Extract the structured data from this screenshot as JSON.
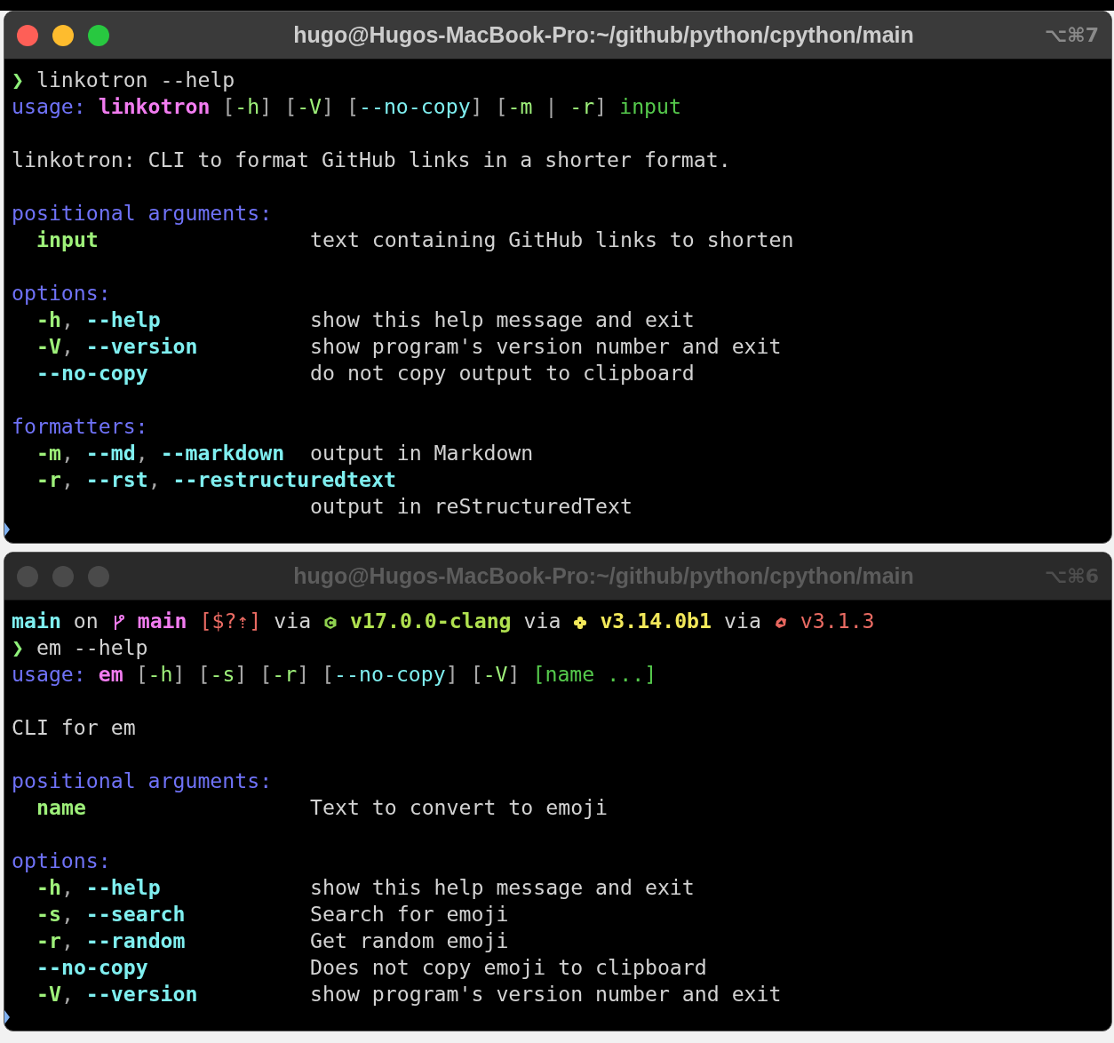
{
  "windows": [
    {
      "title": "hugo@Hugos-MacBook-Pro:~/github/python/cpython/main",
      "shortcut": "⌥⌘7",
      "active": true,
      "lines": [
        {
          "kind": "command",
          "prompt": "❯",
          "text": "linkotron --help"
        },
        {
          "kind": "tokens",
          "groups": [
            [
              {
                "text": "usage:",
                "kind": "label"
              }
            ],
            [
              {
                "text": "linkotron",
                "kind": "prog"
              }
            ],
            [
              {
                "text": "[",
                "kind": "bracket"
              },
              {
                "text": "-h",
                "kind": "short"
              },
              {
                "text": "]",
                "kind": "bracket"
              }
            ],
            [
              {
                "text": "[",
                "kind": "bracket"
              },
              {
                "text": "-V",
                "kind": "short"
              },
              {
                "text": "]",
                "kind": "bracket"
              }
            ],
            [
              {
                "text": "[",
                "kind": "bracket"
              },
              {
                "text": "--no-copy",
                "kind": "long"
              },
              {
                "text": "]",
                "kind": "bracket"
              }
            ],
            [
              {
                "text": "[",
                "kind": "bracket"
              },
              {
                "text": "-m",
                "kind": "short"
              }
            ],
            [
              {
                "text": "|",
                "kind": "bracket"
              }
            ],
            [
              {
                "text": "-r",
                "kind": "short"
              },
              {
                "text": "]",
                "kind": "bracket"
              }
            ],
            [
              {
                "text": "input",
                "kind": "meta"
              }
            ]
          ]
        },
        {
          "kind": "blank"
        },
        {
          "kind": "plain",
          "text": "linkotron: CLI to format GitHub links in a shorter format."
        },
        {
          "kind": "blank"
        },
        {
          "kind": "heading",
          "text": "positional arguments:"
        },
        {
          "kind": "option",
          "flags": [
            [
              {
                "text": "input",
                "kind": "short"
              }
            ]
          ],
          "desc": "text containing GitHub links to shorten"
        },
        {
          "kind": "blank"
        },
        {
          "kind": "heading",
          "text": "options:"
        },
        {
          "kind": "option",
          "flags": [
            [
              {
                "text": "-h",
                "kind": "short"
              },
              {
                "text": ",",
                "kind": "punct"
              }
            ],
            [
              {
                "text": "--help",
                "kind": "long"
              }
            ]
          ],
          "desc": "show this help message and exit"
        },
        {
          "kind": "option",
          "flags": [
            [
              {
                "text": "-V",
                "kind": "short"
              },
              {
                "text": ",",
                "kind": "punct"
              }
            ],
            [
              {
                "text": "--version",
                "kind": "long"
              }
            ]
          ],
          "desc": "show program's version number and exit"
        },
        {
          "kind": "option",
          "flags": [
            [
              {
                "text": "--no-copy",
                "kind": "long"
              }
            ]
          ],
          "desc": "do not copy output to clipboard"
        },
        {
          "kind": "blank"
        },
        {
          "kind": "heading",
          "text": "formatters:"
        },
        {
          "kind": "option",
          "flags": [
            [
              {
                "text": "-m",
                "kind": "short"
              },
              {
                "text": ",",
                "kind": "punct"
              }
            ],
            [
              {
                "text": "--md",
                "kind": "long"
              },
              {
                "text": ",",
                "kind": "punct"
              }
            ],
            [
              {
                "text": "--markdown",
                "kind": "long"
              }
            ]
          ],
          "desc": "output in Markdown"
        },
        {
          "kind": "option",
          "flags": [
            [
              {
                "text": "-r",
                "kind": "short"
              },
              {
                "text": ",",
                "kind": "punct"
              }
            ],
            [
              {
                "text": "--rst",
                "kind": "long"
              },
              {
                "text": ",",
                "kind": "punct"
              }
            ],
            [
              {
                "text": "--restructuredtext",
                "kind": "long"
              }
            ]
          ]
        },
        {
          "kind": "desc",
          "desc": "output in reStructuredText"
        }
      ]
    },
    {
      "title": "hugo@Hugos-MacBook-Pro:~/github/python/cpython/main",
      "shortcut": "⌥⌘6",
      "active": false,
      "lines": [
        {
          "kind": "prompt",
          "dir": "main",
          "on": "on",
          "branch": "main",
          "status": "[$?⇡]",
          "tools": [
            {
              "via": "via",
              "kind": "clang",
              "version": "v17.0.0-clang"
            },
            {
              "via": "via",
              "kind": "python",
              "version": "v3.14.0b1"
            },
            {
              "via": "via",
              "kind": "ruby",
              "version": "v3.1.3"
            }
          ]
        },
        {
          "kind": "command",
          "prompt": "❯",
          "text": "em --help"
        },
        {
          "kind": "tokens",
          "groups": [
            [
              {
                "text": "usage:",
                "kind": "label"
              }
            ],
            [
              {
                "text": "em",
                "kind": "prog"
              }
            ],
            [
              {
                "text": "[",
                "kind": "bracket"
              },
              {
                "text": "-h",
                "kind": "short"
              },
              {
                "text": "]",
                "kind": "bracket"
              }
            ],
            [
              {
                "text": "[",
                "kind": "bracket"
              },
              {
                "text": "-s",
                "kind": "short"
              },
              {
                "text": "]",
                "kind": "bracket"
              }
            ],
            [
              {
                "text": "[",
                "kind": "bracket"
              },
              {
                "text": "-r",
                "kind": "short"
              },
              {
                "text": "]",
                "kind": "bracket"
              }
            ],
            [
              {
                "text": "[",
                "kind": "bracket"
              },
              {
                "text": "--no-copy",
                "kind": "long"
              },
              {
                "text": "]",
                "kind": "bracket"
              }
            ],
            [
              {
                "text": "[",
                "kind": "bracket"
              },
              {
                "text": "-V",
                "kind": "short"
              },
              {
                "text": "]",
                "kind": "bracket"
              }
            ],
            [
              {
                "text": "[name",
                "kind": "meta"
              }
            ],
            [
              {
                "text": "...]",
                "kind": "meta"
              }
            ]
          ]
        },
        {
          "kind": "blank"
        },
        {
          "kind": "plain",
          "text": "CLI for em"
        },
        {
          "kind": "blank"
        },
        {
          "kind": "heading",
          "text": "positional arguments:"
        },
        {
          "kind": "option",
          "flags": [
            [
              {
                "text": "name",
                "kind": "short"
              }
            ]
          ],
          "desc": "Text to convert to emoji"
        },
        {
          "kind": "blank"
        },
        {
          "kind": "heading",
          "text": "options:"
        },
        {
          "kind": "option",
          "flags": [
            [
              {
                "text": "-h",
                "kind": "short"
              },
              {
                "text": ",",
                "kind": "punct"
              }
            ],
            [
              {
                "text": "--help",
                "kind": "long"
              }
            ]
          ],
          "desc": "show this help message and exit"
        },
        {
          "kind": "option",
          "flags": [
            [
              {
                "text": "-s",
                "kind": "short"
              },
              {
                "text": ",",
                "kind": "punct"
              }
            ],
            [
              {
                "text": "--search",
                "kind": "long"
              }
            ]
          ],
          "desc": "Search for emoji"
        },
        {
          "kind": "option",
          "flags": [
            [
              {
                "text": "-r",
                "kind": "short"
              },
              {
                "text": ",",
                "kind": "punct"
              }
            ],
            [
              {
                "text": "--random",
                "kind": "long"
              }
            ]
          ],
          "desc": "Get random emoji"
        },
        {
          "kind": "option",
          "flags": [
            [
              {
                "text": "--no-copy",
                "kind": "long"
              }
            ]
          ],
          "desc": "Does not copy emoji to clipboard"
        },
        {
          "kind": "option",
          "flags": [
            [
              {
                "text": "-V",
                "kind": "short"
              },
              {
                "text": ",",
                "kind": "punct"
              }
            ],
            [
              {
                "text": "--version",
                "kind": "long"
              }
            ]
          ],
          "desc": "show program's version number and exit"
        }
      ]
    }
  ]
}
